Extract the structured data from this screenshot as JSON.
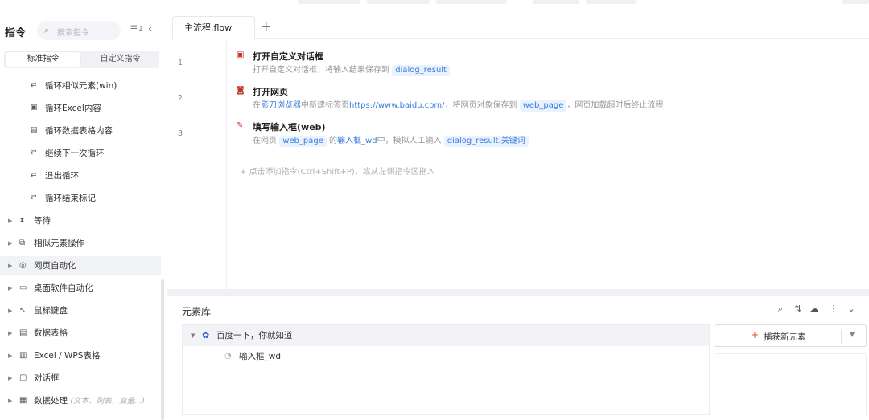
{
  "sidebar": {
    "title": "指令",
    "search_placeholder": "搜索指令",
    "tabs": [
      "标准指令",
      "自定义指令"
    ],
    "loop_items": [
      {
        "icon": "loop-icon",
        "label": "循环相似元素(win)"
      },
      {
        "icon": "excel-loop-icon",
        "label": "循环Excel内容"
      },
      {
        "icon": "table-loop-icon",
        "label": "循环数据表格内容"
      },
      {
        "icon": "continue-icon",
        "label": "继续下一次循环"
      },
      {
        "icon": "break-icon",
        "label": "退出循环"
      },
      {
        "icon": "loop-end-icon",
        "label": "循环结束标记"
      }
    ],
    "categories": [
      {
        "icon": "hourglass-icon",
        "label": "等待",
        "hint": ""
      },
      {
        "icon": "similar-elements-icon",
        "label": "相似元素操作",
        "hint": ""
      },
      {
        "icon": "chrome-icon",
        "label": "网页自动化",
        "hint": ""
      },
      {
        "icon": "monitor-icon",
        "label": "桌面软件自动化",
        "hint": ""
      },
      {
        "icon": "cursor-icon",
        "label": "鼠标键盘",
        "hint": ""
      },
      {
        "icon": "table-icon",
        "label": "数据表格",
        "hint": ""
      },
      {
        "icon": "excel-icon",
        "label": "Excel / WPS表格",
        "hint": ""
      },
      {
        "icon": "dialog-icon",
        "label": "对话框",
        "hint": ""
      },
      {
        "icon": "data-icon",
        "label": "数据处理",
        "hint": "(文本、列表、变量...)"
      }
    ]
  },
  "editor": {
    "tab_label": "主流程.flow",
    "add_tab": "+",
    "steps": [
      {
        "line": "1",
        "title": "打开自定义对话框",
        "desc_prefix": "打开自定义对话框，将输入结果保存到",
        "var1": "dialog_result"
      },
      {
        "line": "2",
        "title": "打开网页",
        "desc_a": "在",
        "browser": "影刀浏览器",
        "desc_b": "中新建标签页",
        "url": "https://www.baidu.com/",
        "desc_c": "，将网页对象保存到",
        "var1": "web_page",
        "desc_d": "，网页加载超时后终止流程"
      },
      {
        "line": "3",
        "title": "填写输入框(web)",
        "desc_a": "在网页",
        "var1": "web_page",
        "desc_b": "的",
        "element": "输入框_wd",
        "desc_c": "中，模拟人工输入",
        "var2": "dialog_result.关键词"
      }
    ],
    "add_hint": "+ 点击添加指令(Ctrl+Shift+P)，或从左侧指令区拖入"
  },
  "element_library": {
    "title": "元素库",
    "group": "百度一下，你就知道",
    "element": "输入框_wd",
    "capture_button": "捕获新元素"
  },
  "colors": {
    "accent": "#3b7ddd",
    "tag_bg": "#e9f2ff",
    "capture_plus": "#e74c3c"
  }
}
